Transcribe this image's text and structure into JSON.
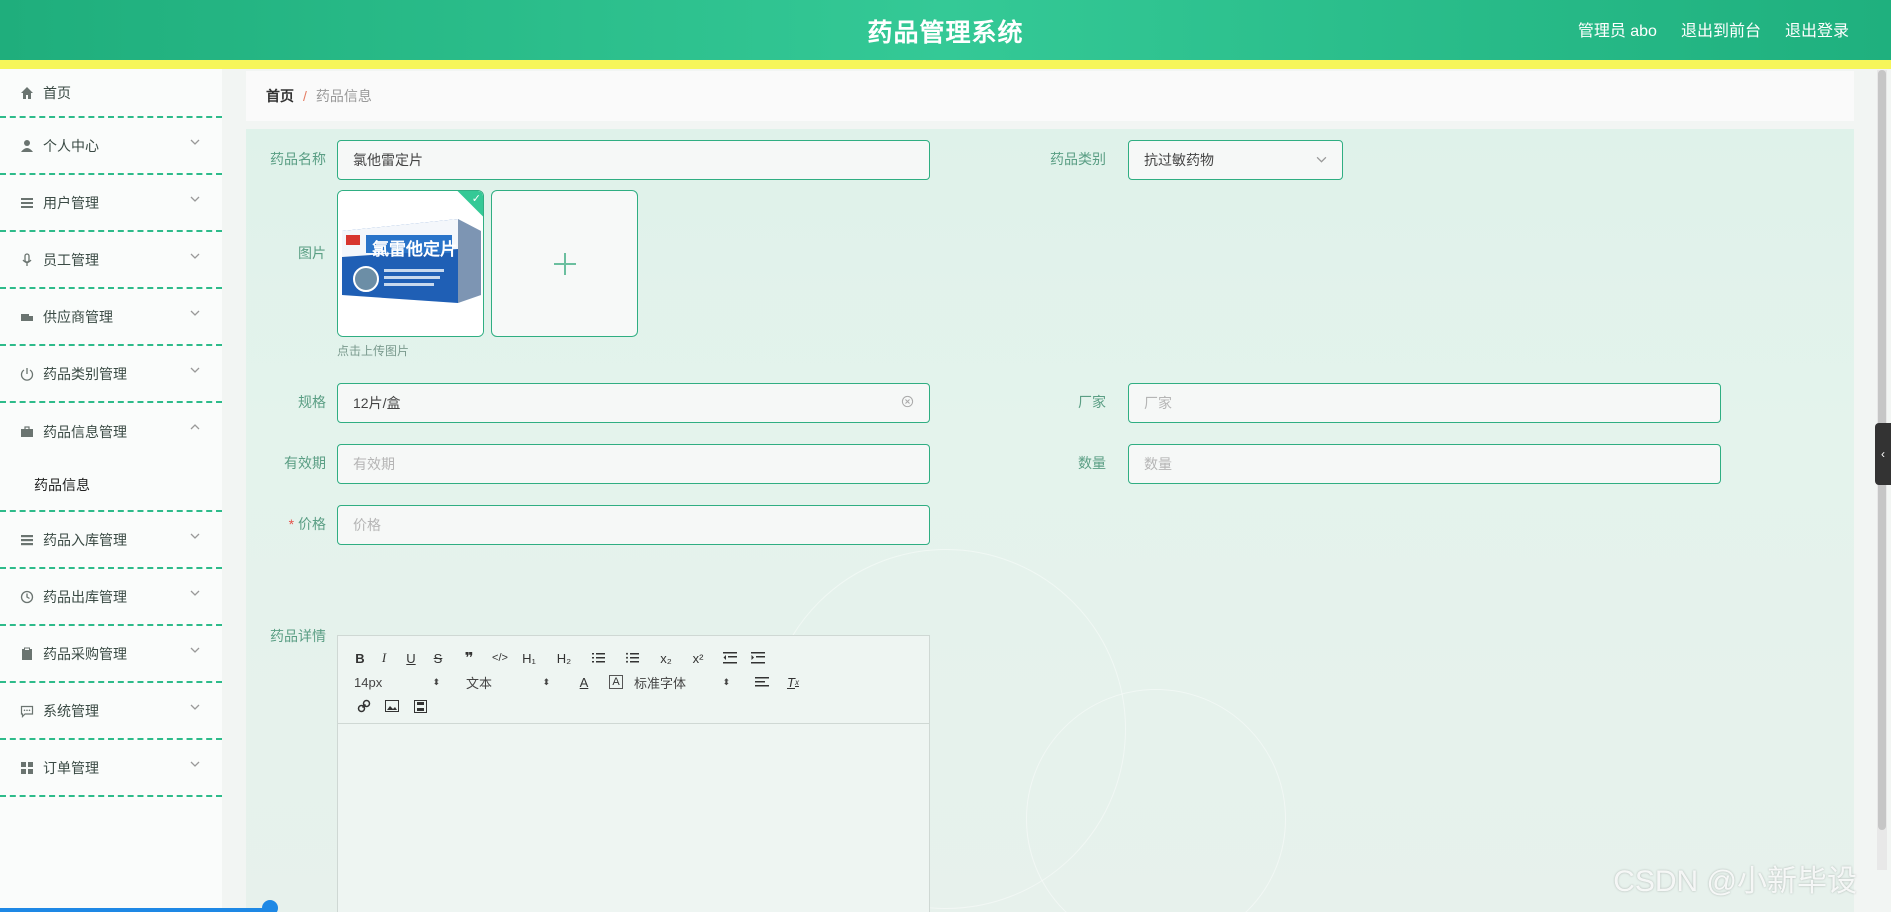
{
  "header": {
    "title": "药品管理系统",
    "user": "管理员 abo",
    "front_link": "退出到前台",
    "logout": "退出登录"
  },
  "sidebar": {
    "items": [
      {
        "label": "首页",
        "icon": "home-icon"
      },
      {
        "label": "个人中心",
        "icon": "user-icon"
      },
      {
        "label": "用户管理",
        "icon": "list-icon"
      },
      {
        "label": "员工管理",
        "icon": "mic-icon"
      },
      {
        "label": "供应商管理",
        "icon": "truck-icon"
      },
      {
        "label": "药品类别管理",
        "icon": "power-icon"
      },
      {
        "label": "药品信息管理",
        "icon": "briefcase-icon"
      },
      {
        "label": "药品入库管理",
        "icon": "menu-icon"
      },
      {
        "label": "药品出库管理",
        "icon": "clock-icon"
      },
      {
        "label": "药品采购管理",
        "icon": "clipboard-icon"
      },
      {
        "label": "系统管理",
        "icon": "chat-icon"
      },
      {
        "label": "订单管理",
        "icon": "grid-icon"
      }
    ],
    "submenu_active": "药品信息"
  },
  "breadcrumb": {
    "home": "首页",
    "separator": "/",
    "current": "药品信息"
  },
  "form": {
    "name_label": "药品名称",
    "name_value": "氯他雷定片",
    "category_label": "药品类别",
    "category_value": "抗过敏药物",
    "image_label": "图片",
    "image_product_text": "氯雷他定片",
    "upload_hint": "点击上传图片",
    "spec_label": "规格",
    "spec_value": "12片/盒",
    "manufacturer_label": "厂家",
    "manufacturer_placeholder": "厂家",
    "expiry_label": "有效期",
    "expiry_placeholder": "有效期",
    "quantity_label": "数量",
    "quantity_placeholder": "数量",
    "price_required": "*",
    "price_label": "价格",
    "price_placeholder": "价格",
    "detail_label": "药品详情"
  },
  "editor": {
    "font_size": "14px",
    "format": "文本",
    "font_family": "标准字体"
  },
  "watermark": "CSDN @小新毕设",
  "colors": {
    "accent": "#2fae82",
    "header": "#34c996",
    "stripe": "#f6f65a"
  }
}
